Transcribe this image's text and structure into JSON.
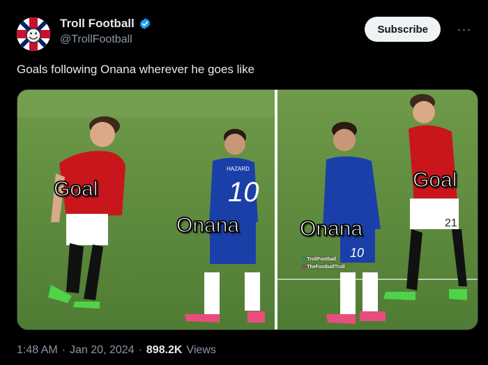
{
  "post": {
    "author": {
      "display_name": "Troll Football",
      "handle": "@TrollFootball",
      "verified": true,
      "avatar_icon": "troll-football-logo"
    },
    "subscribe_label": "Subscribe",
    "more_label": "···",
    "text": "Goals following Onana wherever he goes like",
    "media": {
      "left_panel": {
        "label_goal": "Goal",
        "label_onana": "Onana"
      },
      "right_panel": {
        "label_goal": "Goal",
        "label_onana": "Onana",
        "watermark_1": "TrollFootball",
        "watermark_2": "TheFootballTroll"
      }
    },
    "footer": {
      "time": "1:48 AM",
      "separator": "·",
      "date": "Jan 20, 2024",
      "views_count": "898.2K",
      "views_label": "Views"
    }
  },
  "colors": {
    "background": "#000000",
    "text_primary": "#e7e9ea",
    "text_secondary": "#8b98a5",
    "verified_blue": "#1d9bf0",
    "button_bg": "#eff3f4",
    "pitch_green": "#5d8a3f"
  }
}
